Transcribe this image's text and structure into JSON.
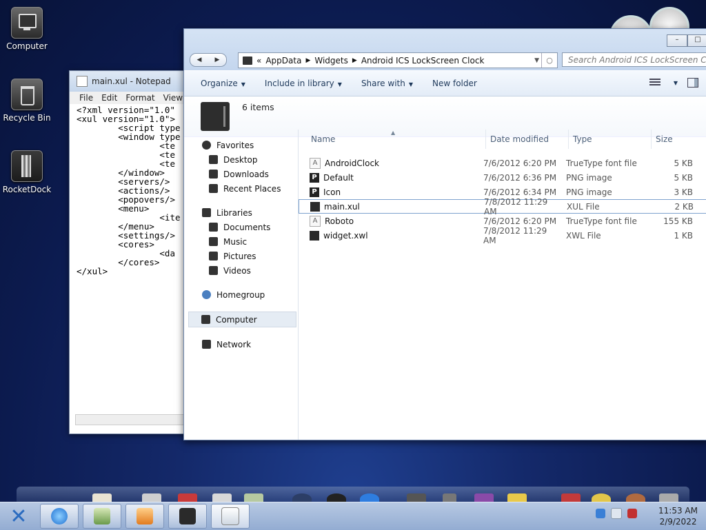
{
  "desktop": {
    "icons": [
      {
        "label": "Computer"
      },
      {
        "label": "Recycle Bin"
      },
      {
        "label": "RocketDock"
      }
    ]
  },
  "notepad": {
    "title": "main.xul - Notepad",
    "menu": [
      "File",
      "Edit",
      "Format",
      "View"
    ],
    "content": "<?xml version=\"1.0\"\n<xul version=\"1.0\">\n        <script type\n        <window type\n                <te\n                <te\n                <te\n        </window>\n        <servers/>\n        <actions/>\n        <popovers/>\n        <menu>\n                <ite\n        </menu>\n        <settings/>\n        <cores>\n                <da\n        </cores>\n</xul>"
  },
  "explorer": {
    "address": {
      "overflow": "«",
      "crumbs": [
        "AppData",
        "Widgets",
        "Android ICS LockScreen Clock"
      ]
    },
    "search_placeholder": "Search Android ICS LockScreen Clock",
    "toolbar": {
      "organize": "Organize",
      "include": "Include in library",
      "share": "Share with",
      "new_folder": "New folder"
    },
    "details": {
      "count": "6 items"
    },
    "nav": {
      "favorites": "Favorites",
      "desktop": "Desktop",
      "downloads": "Downloads",
      "recent": "Recent Places",
      "libraries": "Libraries",
      "documents": "Documents",
      "music": "Music",
      "pictures": "Pictures",
      "videos": "Videos",
      "homegroup": "Homegroup",
      "computer": "Computer",
      "network": "Network"
    },
    "columns": {
      "name": "Name",
      "date": "Date modified",
      "type": "Type",
      "size": "Size"
    },
    "files": [
      {
        "name": "AndroidClock",
        "date": "7/6/2012 6:20 PM",
        "type": "TrueType font file",
        "size": "5 KB",
        "icon": "font-file-icon"
      },
      {
        "name": "Default",
        "date": "7/6/2012 6:36 PM",
        "type": "PNG image",
        "size": "5 KB",
        "icon": "png-file-icon"
      },
      {
        "name": "Icon",
        "date": "7/6/2012 6:34 PM",
        "type": "PNG image",
        "size": "3 KB",
        "icon": "png-file-icon"
      },
      {
        "name": "main.xul",
        "date": "7/8/2012 11:29 AM",
        "type": "XUL File",
        "size": "2 KB",
        "icon": "xul-file-icon"
      },
      {
        "name": "Roboto",
        "date": "7/6/2012 6:20 PM",
        "type": "TrueType font file",
        "size": "155 KB",
        "icon": "font-file-icon"
      },
      {
        "name": "widget.xwl",
        "date": "7/8/2012 11:29 AM",
        "type": "XWL File",
        "size": "1 KB",
        "icon": "xwl-file-icon"
      }
    ]
  },
  "taskbar": {
    "time": "11:53 AM",
    "date": "2/9/2022"
  },
  "colors": {
    "accent": "#1e395b",
    "desktop_bg": "#14296a",
    "taskbar": "#a6bbdb"
  }
}
